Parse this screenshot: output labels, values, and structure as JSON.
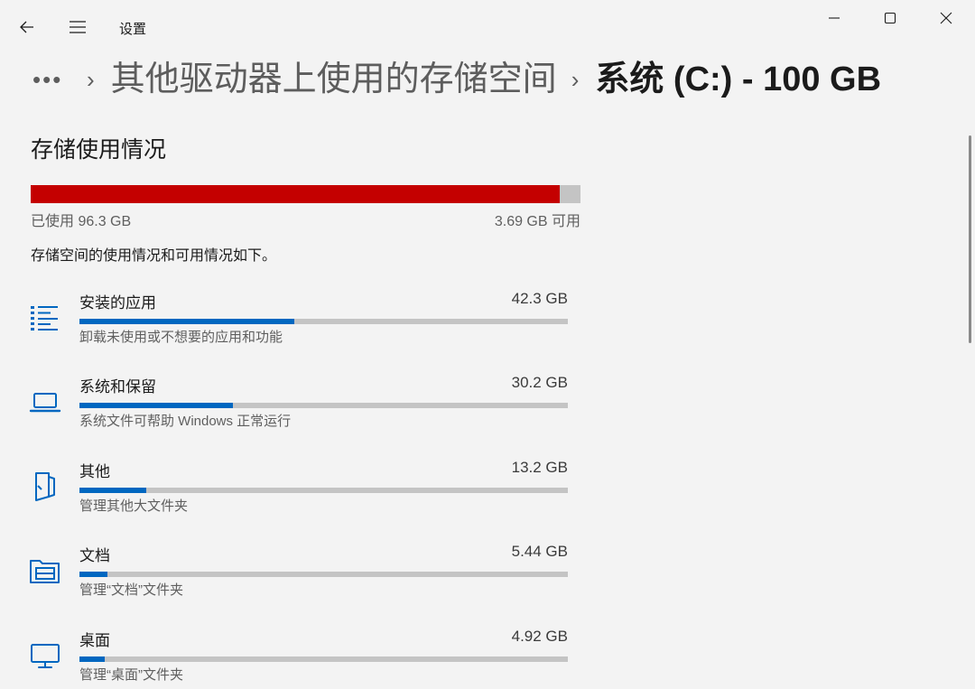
{
  "window": {
    "title": "设置"
  },
  "breadcrumb": {
    "more": "•••",
    "separator": "›",
    "parent": "其他驱动器上使用的存储空间",
    "current": "系统 (C:) - 100 GB"
  },
  "storage": {
    "title": "存储使用情况",
    "used_label": "已使用 96.3 GB",
    "free_label": "3.69 GB 可用",
    "used_fraction": 0.963,
    "description": "存储空间的使用情况和可用情况如下。",
    "categories": [
      {
        "icon": "apps-list-icon",
        "name": "安装的应用",
        "size": "42.3 GB",
        "fraction": 0.44,
        "subtitle": "卸载未使用或不想要的应用和功能"
      },
      {
        "icon": "laptop-icon",
        "name": "系统和保留",
        "size": "30.2 GB",
        "fraction": 0.314,
        "subtitle": "系统文件可帮助 Windows 正常运行"
      },
      {
        "icon": "other-folder-icon",
        "name": "其他",
        "size": "13.2 GB",
        "fraction": 0.137,
        "subtitle": "管理其他大文件夹"
      },
      {
        "icon": "documents-icon",
        "name": "文档",
        "size": "5.44 GB",
        "fraction": 0.057,
        "subtitle": "管理“文档”文件夹"
      },
      {
        "icon": "desktop-icon",
        "name": "桌面",
        "size": "4.92 GB",
        "fraction": 0.051,
        "subtitle": "管理“桌面”文件夹"
      }
    ]
  },
  "colors": {
    "used_bar": "#c40000",
    "category_bar": "#0067c0",
    "track": "#c4c4c4",
    "icon_accent": "#0067c0"
  }
}
